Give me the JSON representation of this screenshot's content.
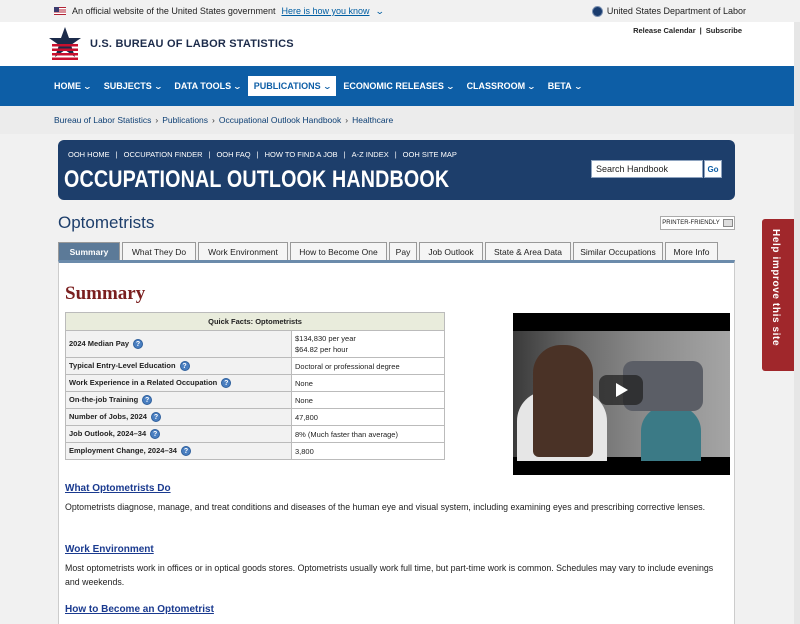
{
  "gov_banner": {
    "text": "An official website of the United States government",
    "link": "Here is how you know",
    "department": "United States Department of Labor"
  },
  "header": {
    "agency": "U.S. BUREAU OF LABOR STATISTICS",
    "release_calendar": "Release Calendar",
    "subscribe": "Subscribe",
    "separator": "|"
  },
  "nav": {
    "items": [
      "HOME",
      "SUBJECTS",
      "DATA TOOLS",
      "PUBLICATIONS",
      "ECONOMIC RELEASES",
      "CLASSROOM",
      "BETA"
    ],
    "active": "PUBLICATIONS"
  },
  "breadcrumb": [
    "Bureau of Labor Statistics",
    "Publications",
    "Occupational Outlook Handbook",
    "Healthcare"
  ],
  "ooh": {
    "links": [
      "OOH HOME",
      "OCCUPATION FINDER",
      "OOH FAQ",
      "HOW TO FIND A JOB",
      "A-Z INDEX",
      "OOH SITE MAP"
    ],
    "title": "OCCUPATIONAL OUTLOOK HANDBOOK",
    "search_value": "Search Handbook",
    "go": "Go"
  },
  "page": {
    "title": "Optometrists",
    "printer_friendly": "PRINTER-FRIENDLY"
  },
  "tabs": [
    "Summary",
    "What They Do",
    "Work Environment",
    "How to Become One",
    "Pay",
    "Job Outlook",
    "State & Area Data",
    "Similar Occupations",
    "More Info"
  ],
  "summary": {
    "heading": "Summary",
    "quick_facts_title": "Quick Facts: Optometrists",
    "rows": [
      {
        "label": "2024 Median Pay",
        "value": "$134,830 per year",
        "value2": "$64.82 per hour"
      },
      {
        "label": "Typical Entry-Level Education",
        "value": "Doctoral or professional degree"
      },
      {
        "label": "Work Experience in a Related Occupation",
        "value": "None"
      },
      {
        "label": "On-the-job Training",
        "value": "None"
      },
      {
        "label": "Number of Jobs, 2024",
        "value": "47,800"
      },
      {
        "label": "Job Outlook, 2024–34",
        "value": "8% (Much faster than average)"
      },
      {
        "label": "Employment Change, 2024–34",
        "value": "3,800"
      }
    ],
    "help_glyph": "?"
  },
  "sections": [
    {
      "title": "What Optometrists Do",
      "text": "Optometrists diagnose, manage, and treat conditions and diseases of the human eye and visual system, including examining eyes and prescribing corrective lenses."
    },
    {
      "title": "Work Environment",
      "text": "Most optometrists work in offices or in optical goods stores. Optometrists usually work full time, but part-time work is common. Schedules may vary to include evenings and weekends."
    },
    {
      "title": "How to Become an Optometrist",
      "text": ""
    }
  ],
  "help_tab": "Help improve this site"
}
